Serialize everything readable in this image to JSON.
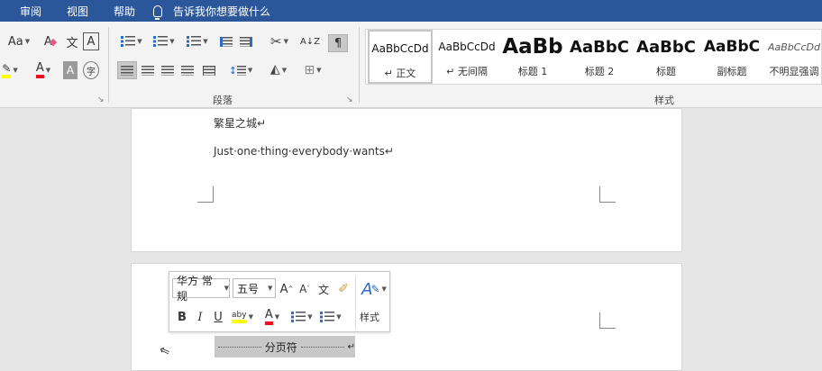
{
  "menu": {
    "items": [
      "审阅",
      "视图",
      "帮助"
    ],
    "tell_me": "告诉我你想要做什么"
  },
  "ribbon": {
    "font": {
      "change_case": "Aa",
      "clear_format": "A",
      "phonetic": "文",
      "char_border": "A",
      "highlight": "ab",
      "font_color": "A",
      "char_shading": "A",
      "enclose": "字"
    },
    "paragraph": {
      "label": "段落",
      "sort": "A↓Z",
      "show_marks": "¶"
    },
    "styles": {
      "label": "样式",
      "tiles": [
        {
          "sample": "AaBbCcDd",
          "name": "↵ 正文"
        },
        {
          "sample": "AaBbCcDd",
          "name": "↵ 无间隔"
        },
        {
          "sample": "AaBb",
          "name": "标题 1"
        },
        {
          "sample": "AaBbC",
          "name": "标题 2"
        },
        {
          "sample": "AaBbC",
          "name": "标题"
        },
        {
          "sample": "AaBbC",
          "name": "副标题"
        },
        {
          "sample": "AaBbCcDd",
          "name": "不明显强调"
        }
      ]
    }
  },
  "document": {
    "line1": "繁星之城↵",
    "line2": "Just·one·thing·everybody·wants↵",
    "page_break": "分页符"
  },
  "mini_toolbar": {
    "font_name": "华方 常规",
    "font_size": "五号",
    "grow": "A",
    "shrink": "A",
    "phonetic": "文",
    "styles_label": "样式",
    "bold": "B",
    "italic": "I",
    "underline": "U",
    "highlight": "aby",
    "font_color": "A"
  },
  "colors": {
    "accent": "#2b579a",
    "highlight_yellow": "#ffff00",
    "font_red": "#e81123"
  }
}
